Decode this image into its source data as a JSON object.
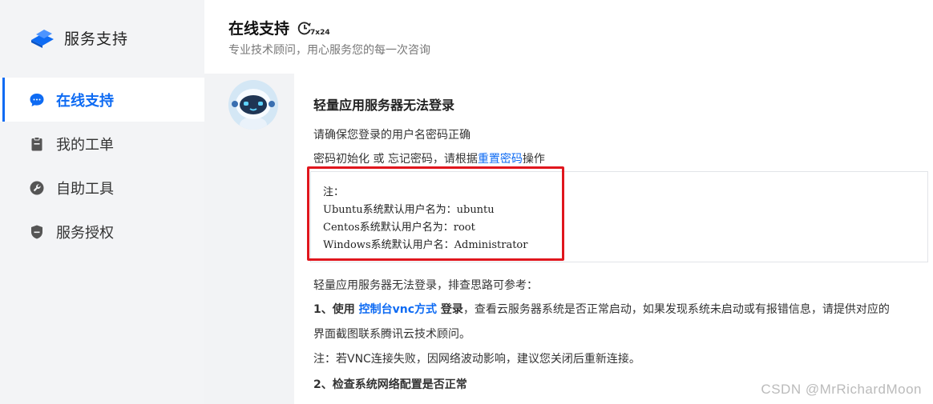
{
  "brand": {
    "title": "服务支持",
    "icon": "cloud-logo-icon",
    "color": "#0e6bf3"
  },
  "sidebar": {
    "items": [
      {
        "label": "在线支持",
        "icon": "chat-bubble-icon",
        "active": true
      },
      {
        "label": "我的工单",
        "icon": "clipboard-icon",
        "active": false
      },
      {
        "label": "自助工具",
        "icon": "wrench-icon",
        "active": false
      },
      {
        "label": "服务授权",
        "icon": "shield-icon",
        "active": false
      }
    ]
  },
  "header": {
    "title": "在线支持",
    "badge": "7x24",
    "subtitle": "专业技术顾问，用心服务您的每一次咨询"
  },
  "message": {
    "title": "轻量应用服务器无法登录",
    "line1": "请确保您登录的用户名密码正确",
    "line2_prefix": "密码初始化 或 忘记密码，请根据",
    "line2_link": "重置密码",
    "line2_suffix": "操作",
    "note": {
      "heading": "注：",
      "lines": [
        "Ubuntu系统默认用户名为：ubuntu",
        "Centos系统默认用户名为：root",
        "Windows系统默认用户名：Administrator"
      ]
    },
    "troubleshoot_intro": "轻量应用服务器无法登录，排查思路可参考：",
    "step1_prefix": "1、使用 ",
    "step1_link": "控制台vnc方式",
    "step1_bold": " 登录",
    "step1_text": "，查看云服务器系统是否正常启动，如果发现系统未启动或有报错信息，请提供对应的",
    "step1_text2": "界面截图联系腾讯云技术顾问。",
    "vnc_note": "注：若VNC连接失败，因网络波动影响，建议您关闭后重新连接。",
    "step2": "2、检查系统网络配置是否正常"
  },
  "watermark": "CSDN @MrRichardMoon",
  "colors": {
    "accent": "#0e6bf3",
    "highlight": "#e0161d"
  }
}
